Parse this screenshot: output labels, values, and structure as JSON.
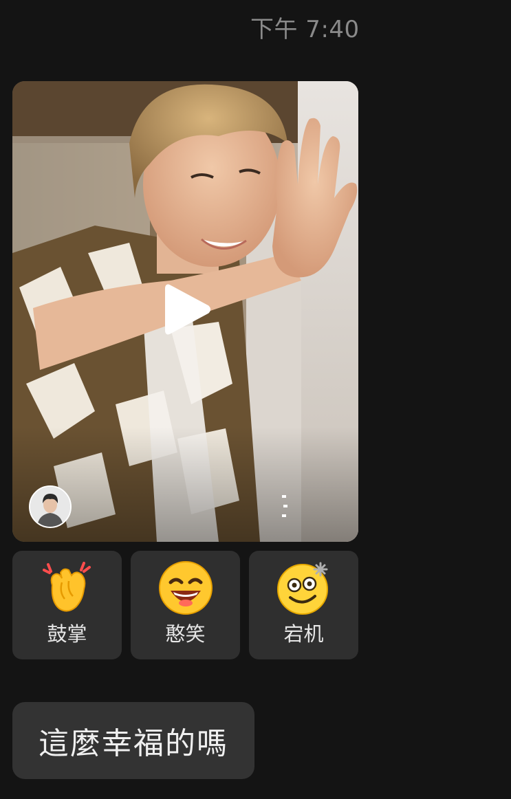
{
  "chat": {
    "timestamp": "下午 7:40",
    "video_message": {
      "play_icon": "play-icon",
      "avatar_icon": "user-avatar",
      "more_icon": "more-dots-icon"
    },
    "quick_reactions": [
      {
        "emoji": "clapping-hands-emoji",
        "label": "鼓掌"
      },
      {
        "emoji": "grinning-face-emoji",
        "label": "憨笑"
      },
      {
        "emoji": "dizzy-face-emoji",
        "label": "宕机"
      }
    ],
    "text_message": "這麼幸福的嗎"
  },
  "colors": {
    "background": "#141414",
    "bubble": "#333333",
    "reaction_tile": "#2f2f2f",
    "timestamp": "#8a8a8a"
  }
}
